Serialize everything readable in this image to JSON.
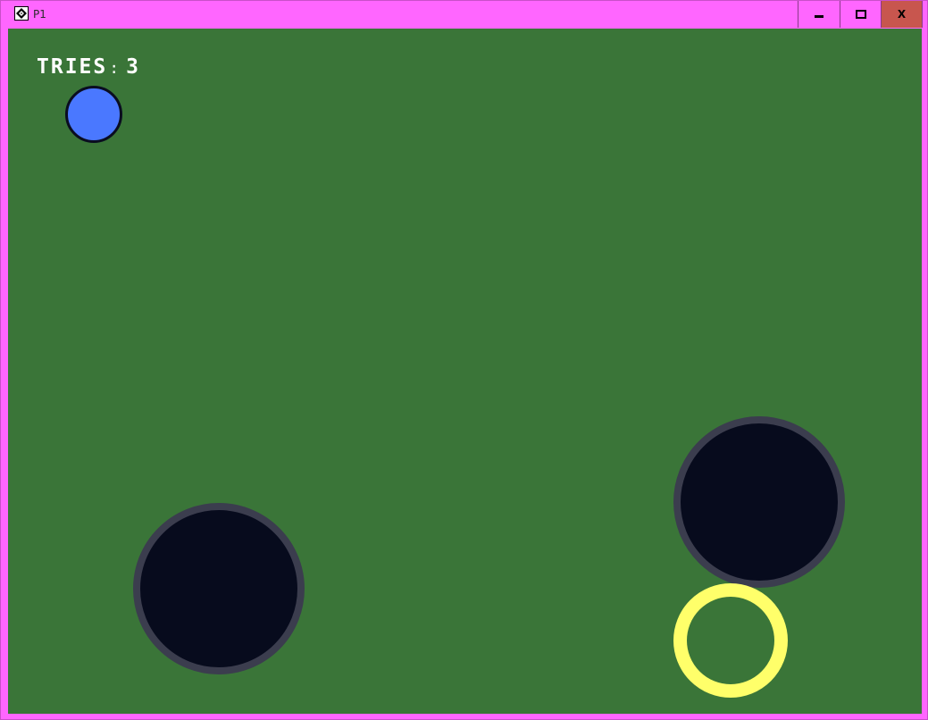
{
  "window": {
    "title": "P1",
    "controls": {
      "minimize_icon": "minimize-icon",
      "maximize_icon": "maximize-icon",
      "close_label": "X"
    },
    "frame_color": "#ff66ff",
    "close_button_color": "#c8564e"
  },
  "game": {
    "background_color": "#3a7538",
    "hud": {
      "tries_label": "TRIES",
      "separator": ":",
      "tries_value": "3"
    },
    "player_ball_color": "#4a78ff",
    "hole_color": "#070b1d",
    "hole_rim_color": "#3b3d4e",
    "goal_color": "#ffff6a"
  }
}
